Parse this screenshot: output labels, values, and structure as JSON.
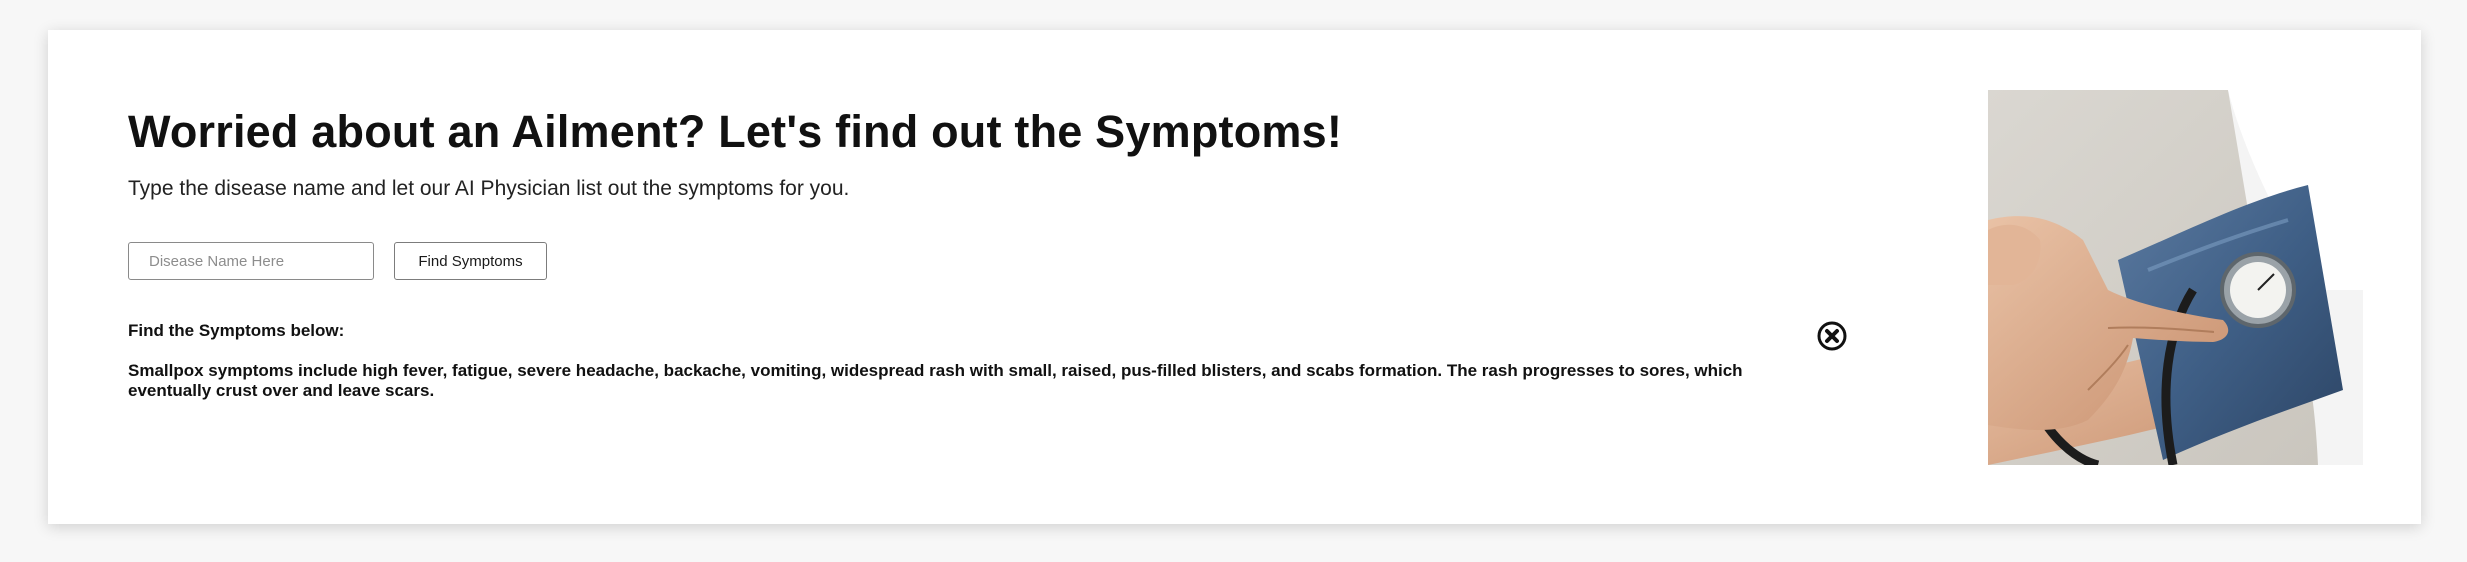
{
  "hero": {
    "title": "Worried about an Ailment? Let's find out the Symptoms!",
    "subtitle": "Type the disease name and let our AI Physician list out the symptoms for you."
  },
  "search": {
    "placeholder": "Disease Name Here",
    "value": "",
    "button_label": "Find Symptoms"
  },
  "result": {
    "heading": "Find the Symptoms below:",
    "text": "Smallpox symptoms include high fever, fatigue, severe headache, backache, vomiting, widespread rash with small, raised, pus-filled blisters, and scabs formation. The rash progresses to sores, which eventually crust over and leave scars.",
    "close_icon": "close-circle-icon"
  },
  "image": {
    "subject": "blood-pressure-measurement-photo"
  },
  "colors": {
    "page_background": "#f7f7f7",
    "card_background": "#ffffff",
    "text": "#111111",
    "border": "#8a8a8a"
  }
}
